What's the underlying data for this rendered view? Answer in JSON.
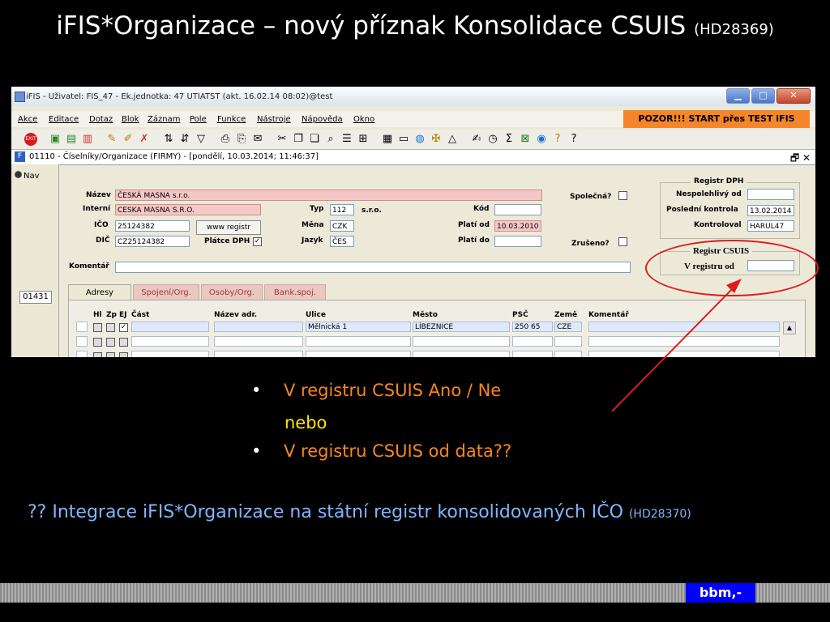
{
  "slide": {
    "title": "iFIS*Organizace – nový příznak Konsolidace CSUIS",
    "title_ref": "(HD28369)",
    "bullets": [
      "V registru CSUIS Ano / Ne",
      "V registru CSUIS od data??"
    ],
    "nebo": "nebo",
    "integrace": "?? Integrace iFIS*Organizace na státní registr konsolidovaných IČO",
    "integrace_ref": "(HD28370)",
    "logo": "bbm,-"
  },
  "window": {
    "title": "iFIS - Uživatel: FIS_47 - Ek.jednotka: 47 UTIATST (akt. 16.02.14 08:02)@test",
    "minimize": "▁",
    "maximize": "□",
    "close": "✕",
    "menu": [
      "Akce",
      "Editace",
      "Dotaz",
      "Blok",
      "Záznam",
      "Pole",
      "Funkce",
      "Nástroje",
      "Nápověda",
      "Okno"
    ],
    "warning": "POZOR!!! START přes TEST iFIS",
    "subwindow_title": "01110 - Číselníky/Organizace (FIRMY) - [pondělí, 10.03.2014; 11:46:37]",
    "subwindow_controls": "🗗 ✕"
  },
  "toolbar_icons": [
    "exit-icon",
    "insert-record-icon",
    "save-record-icon",
    "delete-record-icon",
    "query-icon",
    "execute-query-icon",
    "cancel-query-icon",
    "sort-asc-icon",
    "sort-desc-icon",
    "filter-icon",
    "print-icon",
    "print-preview-icon",
    "mail-icon",
    "cut-icon",
    "copy-icon",
    "paste-icon",
    "find-icon",
    "list-icon",
    "tree-icon",
    "calculator-icon",
    "document-icon",
    "globe-icon",
    "tools-icon",
    "warning-icon",
    "edit-icon",
    "calendar-icon",
    "sum-icon",
    "excel-icon",
    "word-icon",
    "help-icon",
    "question-icon"
  ],
  "form": {
    "nav_label": "Nav",
    "record_number": "01431",
    "nazev_label": "Název",
    "nazev": "ČESKÁ MASNA s.r.o.",
    "interni_label": "Interní",
    "interni": "CESKA MASNA S.R.O.",
    "ico_label": "IČO",
    "ico": "25124382",
    "dic_label": "DIČ",
    "dic": "CZ25124382",
    "www_button": "www registr",
    "platce_label": "Plátce DPH",
    "typ_label": "Typ",
    "typ": "112",
    "typ_desc": "s.r.o.",
    "mena_label": "Měna",
    "mena": "CZK",
    "jazyk_label": "Jazyk",
    "jazyk": "ČES",
    "kod_label": "Kód",
    "kod": "",
    "plati_od_label": "Platí od",
    "plati_od": "10.03.2010",
    "plati_do_label": "Platí do",
    "plati_do": "",
    "spolecna_label": "Společná?",
    "zruseno_label": "Zrušeno?",
    "komentar_label": "Komentář",
    "komentar": "",
    "dph_group": "Registr DPH",
    "nespolehlivy_label": "Nespolehlivý od",
    "nespolehlivy": "",
    "posledni_label": "Poslední kontrola",
    "posledni": "13.02.2014",
    "kontroloval_label": "Kontroloval",
    "kontroloval": "HARUL47",
    "csuis_group": "Registr CSUIS",
    "v_registru_label": "V registru od",
    "v_registru": ""
  },
  "tabs": [
    "Adresy",
    "Spojení/Org.",
    "Osoby/Org.",
    "Bank.spoj."
  ],
  "table": {
    "headers": [
      "Hl",
      "Zp",
      "EJ",
      "Část",
      "Název adr.",
      "Ulice",
      "Město",
      "PSČ",
      "Země",
      "Komentář"
    ],
    "row1": {
      "ulice": "Mělnická 1",
      "mesto": "LÍBEZNICE",
      "psc": "250 65",
      "zeme": "CZE"
    }
  },
  "colors": {
    "warning_bg": "#f5852a",
    "annotation": "#e01b1b",
    "bullet": "#f7871d",
    "integration": "#7fb6ff"
  }
}
